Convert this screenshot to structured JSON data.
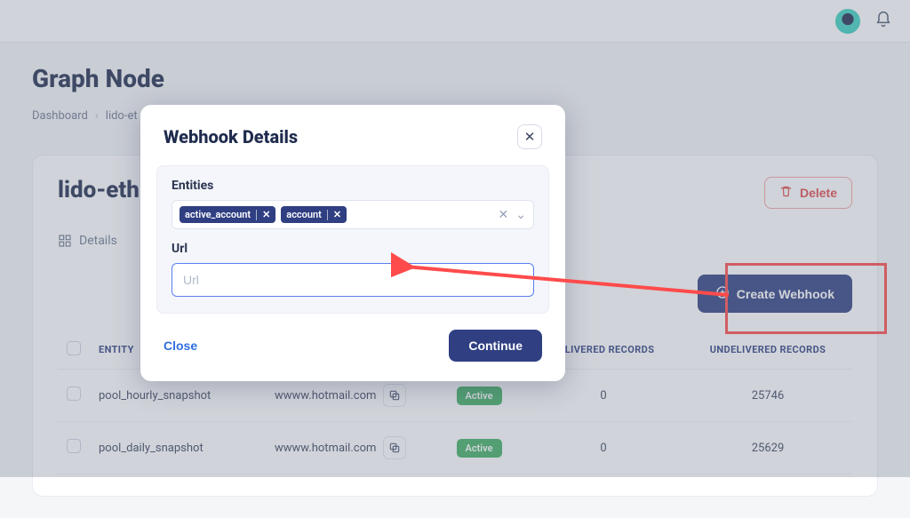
{
  "topbar": {
    "avatar_label": "user avatar",
    "bell_label": "notifications"
  },
  "page": {
    "title": "Graph Node",
    "breadcrumb": [
      "Dashboard",
      "lido-et"
    ]
  },
  "card": {
    "title": "lido-eth",
    "delete_label": "Delete",
    "details_label": "Details",
    "create_webhook_label": "Create Webhook"
  },
  "table": {
    "headers": {
      "entity": "ENTITY",
      "url": "",
      "status": "",
      "delivered": "DELIVERED RECORDS",
      "undelivered": "UNDELIVERED RECORDS"
    },
    "rows": [
      {
        "entity": "pool_hourly_snapshot",
        "url": "wwww.hotmail.com",
        "status": "Active",
        "delivered": "0",
        "undelivered": "25746"
      },
      {
        "entity": "pool_daily_snapshot",
        "url": "wwww.hotmail.com",
        "status": "Active",
        "delivered": "0",
        "undelivered": "25629"
      }
    ]
  },
  "modal": {
    "title": "Webhook Details",
    "entities_label": "Entities",
    "entity_chips": [
      "active_account",
      "account"
    ],
    "url_label": "Url",
    "url_placeholder": "Url",
    "url_value": "",
    "close_label": "Close",
    "continue_label": "Continue"
  }
}
